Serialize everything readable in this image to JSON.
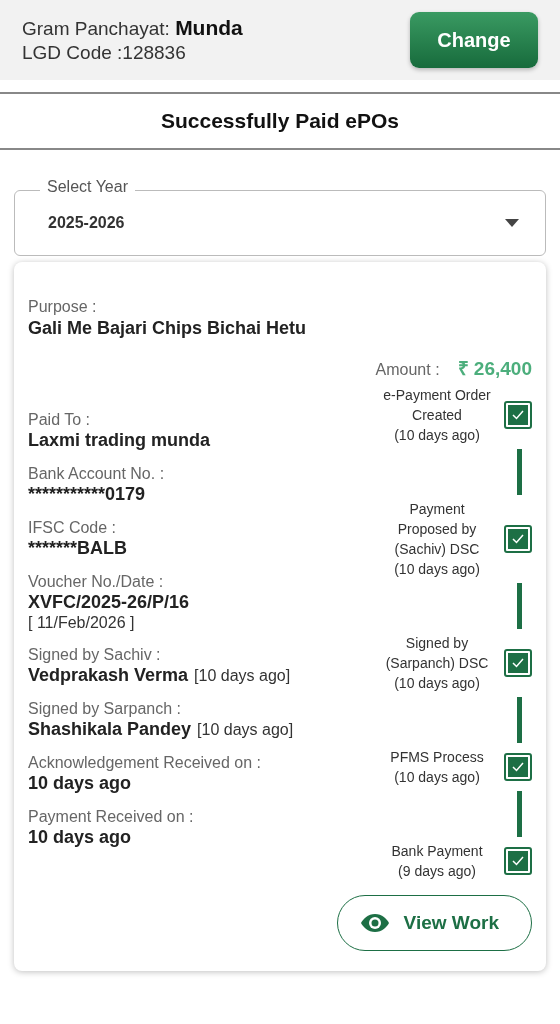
{
  "header": {
    "panchayat_label": "Gram Panchayat:",
    "panchayat_name": "Munda",
    "lgd": "LGD Code :128836",
    "button": "Change"
  },
  "title": "Successfully Paid ePOs",
  "year_select": {
    "label": "Select Year",
    "value": "2025-2026"
  },
  "card": {
    "purpose_label": "Purpose :",
    "purpose": "Gali Me Bajari Chips Bichai Hetu",
    "amount_label": "Amount :",
    "amount": "₹ 26,400",
    "fields": [
      {
        "label": "Paid To :",
        "value": "Laxmi trading munda"
      },
      {
        "label": "Bank Account No. :",
        "value": "***********0179"
      },
      {
        "label": "IFSC Code :",
        "value": "*******BALB"
      },
      {
        "label": "Voucher No./Date :",
        "value": "XVFC/2025-26/P/16",
        "note": "[ 11/Feb/2026 ]",
        "kind": "below"
      },
      {
        "label": "Signed by Sachiv :",
        "value": "Vedprakash Verma",
        "note": "[10 days ago]",
        "kind": "inline"
      },
      {
        "label": "Signed by Sarpanch :",
        "value": "Shashikala Pandey",
        "note": "[10 days ago]",
        "kind": "inline"
      },
      {
        "label": "Acknowledgement Received on :",
        "value": "10 days ago"
      },
      {
        "label": "Payment Received on :",
        "value": "10 days ago"
      }
    ],
    "steps": [
      {
        "label": "e-Payment Order Created",
        "time": "(10 days ago)",
        "checked": true
      },
      {
        "label": "Payment Proposed by (Sachiv) DSC",
        "time": "(10 days ago)",
        "checked": true
      },
      {
        "label": "Signed by (Sarpanch) DSC",
        "time": "(10 days ago)",
        "checked": true
      },
      {
        "label": "PFMS Process",
        "time": "(10 days ago)",
        "checked": true
      },
      {
        "label": "Bank Payment",
        "time": "(9 days ago)",
        "checked": true
      }
    ],
    "button": "View Work"
  }
}
